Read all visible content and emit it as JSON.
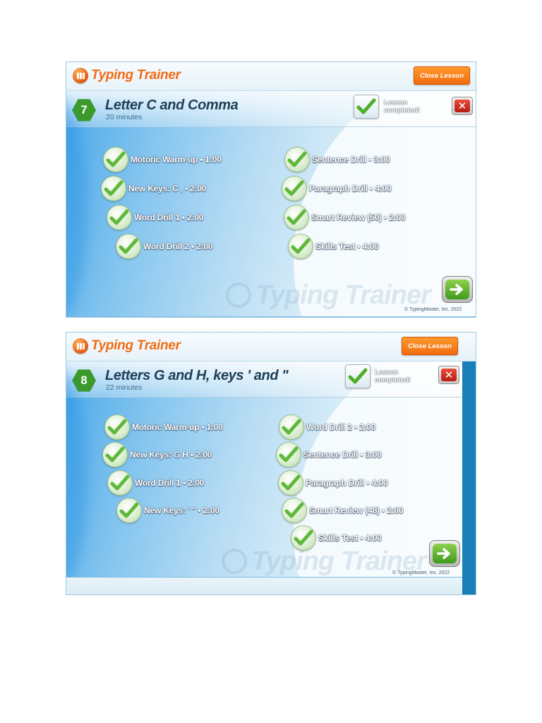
{
  "app": {
    "logo_text": "Typing Trainer",
    "close_lesson_label": "Close Lesson",
    "completed_label_line1": "Lesson",
    "completed_label_line2": "completed!",
    "close_x": "✕",
    "watermark": "Typing Trainer",
    "copyright": "© TypingMaster, Inc. 2022"
  },
  "colors": {
    "accent_orange": "#f26b0c",
    "badge_green": "#3c9a2a",
    "panel_blue": "#4aa8e8",
    "check_green": "#5fb83a"
  },
  "icons": [
    "typing-trainer-logo-icon",
    "check-icon",
    "close-icon",
    "arrow-right-icon"
  ],
  "lessons": [
    {
      "number": "7",
      "title": "Letter C and Comma",
      "duration": "20 minutes",
      "activities": [
        {
          "name": "Motoric Warm-up",
          "time": "1:00"
        },
        {
          "name": "New Keys: C ,",
          "time": "2:00"
        },
        {
          "name": "Word Drill 1",
          "time": "2:00"
        },
        {
          "name": "Word Drill 2",
          "time": "2:00"
        },
        {
          "name": "Sentence Drill",
          "time": "3:00"
        },
        {
          "name": "Paragraph Drill",
          "time": "4:00"
        },
        {
          "name": "Smart Review (50)",
          "time": "2:00"
        },
        {
          "name": "Skills Test",
          "time": "4:00"
        }
      ]
    },
    {
      "number": "8",
      "title": "Letters G and H, keys ' and \"",
      "duration": "22 minutes",
      "activities": [
        {
          "name": "Motoric Warm-up",
          "time": "1:00"
        },
        {
          "name": "New Keys: G H",
          "time": "2:00"
        },
        {
          "name": "Word Drill 1",
          "time": "2:00"
        },
        {
          "name": "New Keys: ' \"",
          "time": "2:00"
        },
        {
          "name": "Word Drill 2",
          "time": "2:00"
        },
        {
          "name": "Sentence Drill",
          "time": "3:00"
        },
        {
          "name": "Paragraph Drill",
          "time": "4:00"
        },
        {
          "name": "Smart Review (48)",
          "time": "2:00"
        },
        {
          "name": "Skills Test",
          "time": "4:00"
        }
      ]
    }
  ]
}
